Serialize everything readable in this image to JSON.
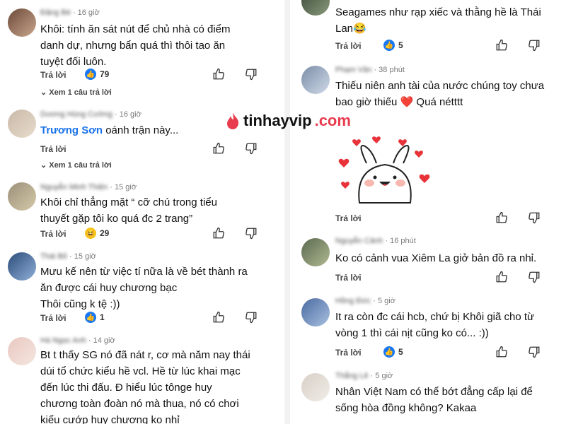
{
  "left": [
    {
      "author": "Đặng Bé",
      "time": "16 giờ",
      "text_lines": [
        "Khôi: tính ăn sát nút để chủ nhà có điểm",
        "danh dự, nhưng bẩn quá thì thôi tao ăn",
        "tuyệt đối luôn."
      ],
      "reply_label": "Trả lời",
      "reaction": "like",
      "reaction_count": "79",
      "see_replies": "Xem 1 câu trả lời"
    },
    {
      "author": "Dương Hùng Cường",
      "time": "16 giờ",
      "mention": "Trương Sơn",
      "text_after_mention": " oánh trận này...",
      "reply_label": "Trả lời",
      "see_replies": "Xem 1 câu trả lời"
    },
    {
      "author": "Nguyễn Minh Thiện",
      "time": "15 giờ",
      "text_lines": [
        "Khôi chỉ thẳng mặt “ cỡ chú trong tiểu",
        "thuyết gặp tôi ko quá đc 2 trang”"
      ],
      "reply_label": "Trả lời",
      "reaction": "haha",
      "reaction_count": "29"
    },
    {
      "author": "Thái Bỏ",
      "time": "15 giờ",
      "text_lines": [
        "Mưu kế nên từ việc tí nữa là về bét thành ra",
        "ăn được cái huy chương bạc",
        "Thôi cũng k tệ :))"
      ],
      "reply_label": "Trả lời",
      "reaction": "like",
      "reaction_count": "1"
    },
    {
      "author": "Hà Ngọc Anh",
      "time": "14 giờ",
      "text_lines": [
        "Bt t thấy SG nó đã nát r, cơ mà năm nay thái",
        "dúi tổ chức kiểu hề vcl. Hề từ lúc khai mạc",
        "đến lúc thi đấu. Đ hiểu lúc tônge huy",
        "chương toàn đoàn nó mà thua, nó có chơi",
        "kiểu cướp huy chương ko nhỉ"
      ]
    }
  ],
  "right": [
    {
      "text_lines": [
        "Seagames như rạp xiếc và thằng hề là Thái",
        "Lan😂"
      ],
      "reply_label": "Trả lời",
      "reaction": "like",
      "reaction_count": "5"
    },
    {
      "author": "Phạm Văn",
      "time": "38 phút",
      "text_line1": "Thiếu niên anh tài của nước chúng toy chưa",
      "text_line2_before": "bao giờ thiếu ",
      "text_line2_after": " Quá nétttt",
      "reply_label": "Trả lời"
    },
    {
      "author": "Nguyễn Cảnh",
      "time": "16 phút",
      "text_lines": [
        "Ko có cảnh vua Xiêm La giở bản đồ ra nhỉ."
      ],
      "reply_label": "Trả lời"
    },
    {
      "author": "Hồng Đức",
      "time": "5 giờ",
      "text_lines": [
        "It ra còn đc cái hcb, chứ bị Khôi giã cho từ",
        "vòng 1 thì cái nịt cũng ko có... :))"
      ],
      "reply_label": "Trả lời",
      "reaction": "like",
      "reaction_count": "5"
    },
    {
      "author": "Thắng Lê",
      "time": "5 giờ",
      "text_lines": [
        "Nhân Việt Nam có thể bớt đẳng cấp lại để",
        "sống hòa đồng không? Kakaa"
      ]
    }
  ],
  "watermark": {
    "brand": "tinhayvip",
    "tld": ".com"
  },
  "colors": {
    "like": "#1877f2",
    "haha": "#f7c31b",
    "mention": "#1a73e8",
    "heart": "#e02020",
    "brand": "#e83b4e"
  }
}
